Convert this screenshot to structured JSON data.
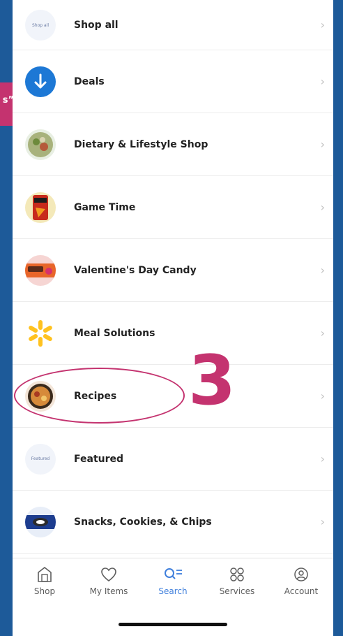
{
  "callout": {
    "text": "s”"
  },
  "categories": [
    {
      "label": "Shop all",
      "thumb_text": "Shop all",
      "icon": "shop-all-icon"
    },
    {
      "label": "Deals",
      "icon": "down-arrow-icon"
    },
    {
      "label": "Dietary & Lifestyle Shop",
      "icon": "salad-bowl-icon"
    },
    {
      "label": "Game Time",
      "icon": "chips-bag-icon",
      "thumb_text": "Doritos"
    },
    {
      "label": "Valentine's Day Candy",
      "icon": "candy-package-icon",
      "thumb_text": "Reese's"
    },
    {
      "label": "Meal Solutions",
      "icon": "walmart-spark-icon"
    },
    {
      "label": "Recipes",
      "icon": "recipe-bowl-icon"
    },
    {
      "label": "Featured",
      "thumb_text": "Featured",
      "icon": "featured-icon"
    },
    {
      "label": "Snacks, Cookies, & Chips",
      "icon": "cookie-package-icon"
    }
  ],
  "annotation": {
    "step": "3"
  },
  "tabs": [
    {
      "label": "Shop",
      "icon": "shop-icon",
      "active": false
    },
    {
      "label": "My Items",
      "icon": "heart-icon",
      "active": false
    },
    {
      "label": "Search",
      "icon": "search-icon",
      "active": true
    },
    {
      "label": "Services",
      "icon": "services-icon",
      "active": false
    },
    {
      "label": "Account",
      "icon": "account-icon",
      "active": false
    }
  ],
  "colors": {
    "background": "#1d5a99",
    "annotation": "#c4336f",
    "active_tab": "#3f7fdc",
    "walmart_yellow": "#ffc220"
  }
}
